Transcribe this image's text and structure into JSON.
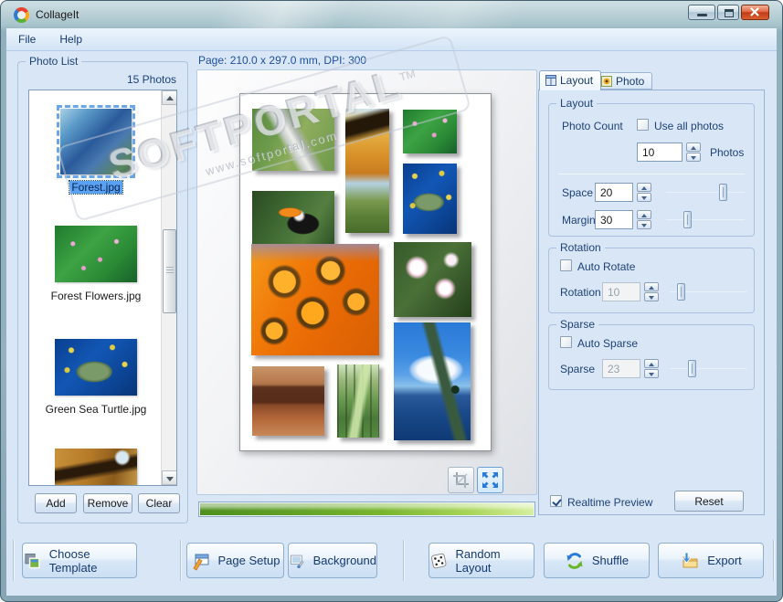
{
  "window": {
    "title": "CollageIt"
  },
  "menu": {
    "items": [
      {
        "label": "File"
      },
      {
        "label": "Help"
      }
    ]
  },
  "page_info": {
    "text": "Page: 210.0 x 297.0 mm, DPI: 300"
  },
  "photo_list": {
    "group_title": "Photo List",
    "count_text": "15 Photos",
    "items": [
      {
        "label": "Forest.jpg",
        "selected": true
      },
      {
        "label": "Forest Flowers.jpg",
        "selected": false
      },
      {
        "label": "Green Sea Turtle.jpg",
        "selected": false
      },
      {
        "label": "",
        "selected": false
      }
    ],
    "add_label": "Add",
    "remove_label": "Remove",
    "clear_label": "Clear"
  },
  "collage": {
    "photos": [
      "river-meadow",
      "autumn-tree",
      "green-flowers",
      "toucan",
      "sea-turtle",
      "orange-daisies",
      "plumeria-flowers",
      "monument-valley",
      "forest-path",
      "ocean-pier"
    ]
  },
  "sidebar": {
    "tabs": [
      {
        "label": "Layout",
        "active": true
      },
      {
        "label": "Photo",
        "active": false
      }
    ],
    "layout": {
      "title": "Layout",
      "photo_count_label": "Photo Count",
      "use_all_label": "Use all photos",
      "use_all_checked": false,
      "count_value": "10",
      "photos_label": "Photos",
      "space_label": "Space",
      "space_value": "20",
      "margin_label": "Margin",
      "margin_value": "30"
    },
    "rotation": {
      "title": "Rotation",
      "auto_label": "Auto Rotate",
      "auto_checked": false,
      "label": "Rotation",
      "value": "10",
      "enabled": false
    },
    "sparse": {
      "title": "Sparse",
      "auto_label": "Auto Sparse",
      "auto_checked": false,
      "label": "Sparse",
      "value": "23",
      "enabled": false
    },
    "realtime_label": "Realtime Preview",
    "realtime_checked": true,
    "reset_label": "Reset"
  },
  "toolbar": {
    "buttons": [
      {
        "label": "Choose Template",
        "icon": "template-icon"
      },
      {
        "label": "Page Setup",
        "icon": "page-setup-icon"
      },
      {
        "label": "Background",
        "icon": "background-icon"
      },
      {
        "label": "Random Layout",
        "icon": "dice-icon"
      },
      {
        "label": "Shuffle",
        "icon": "shuffle-icon"
      },
      {
        "label": "Export",
        "icon": "export-icon"
      }
    ]
  },
  "watermark": {
    "text": "SOFTPORTAL",
    "tm": "TM",
    "url": "www.softportal.com"
  },
  "colors": {
    "selection_blue": "#5aa1f2",
    "progress_green": "#7ab52f",
    "accent_blue": "#2a7ad8",
    "client_bg": "#d8e6f6",
    "text_navy": "#1e4176"
  }
}
